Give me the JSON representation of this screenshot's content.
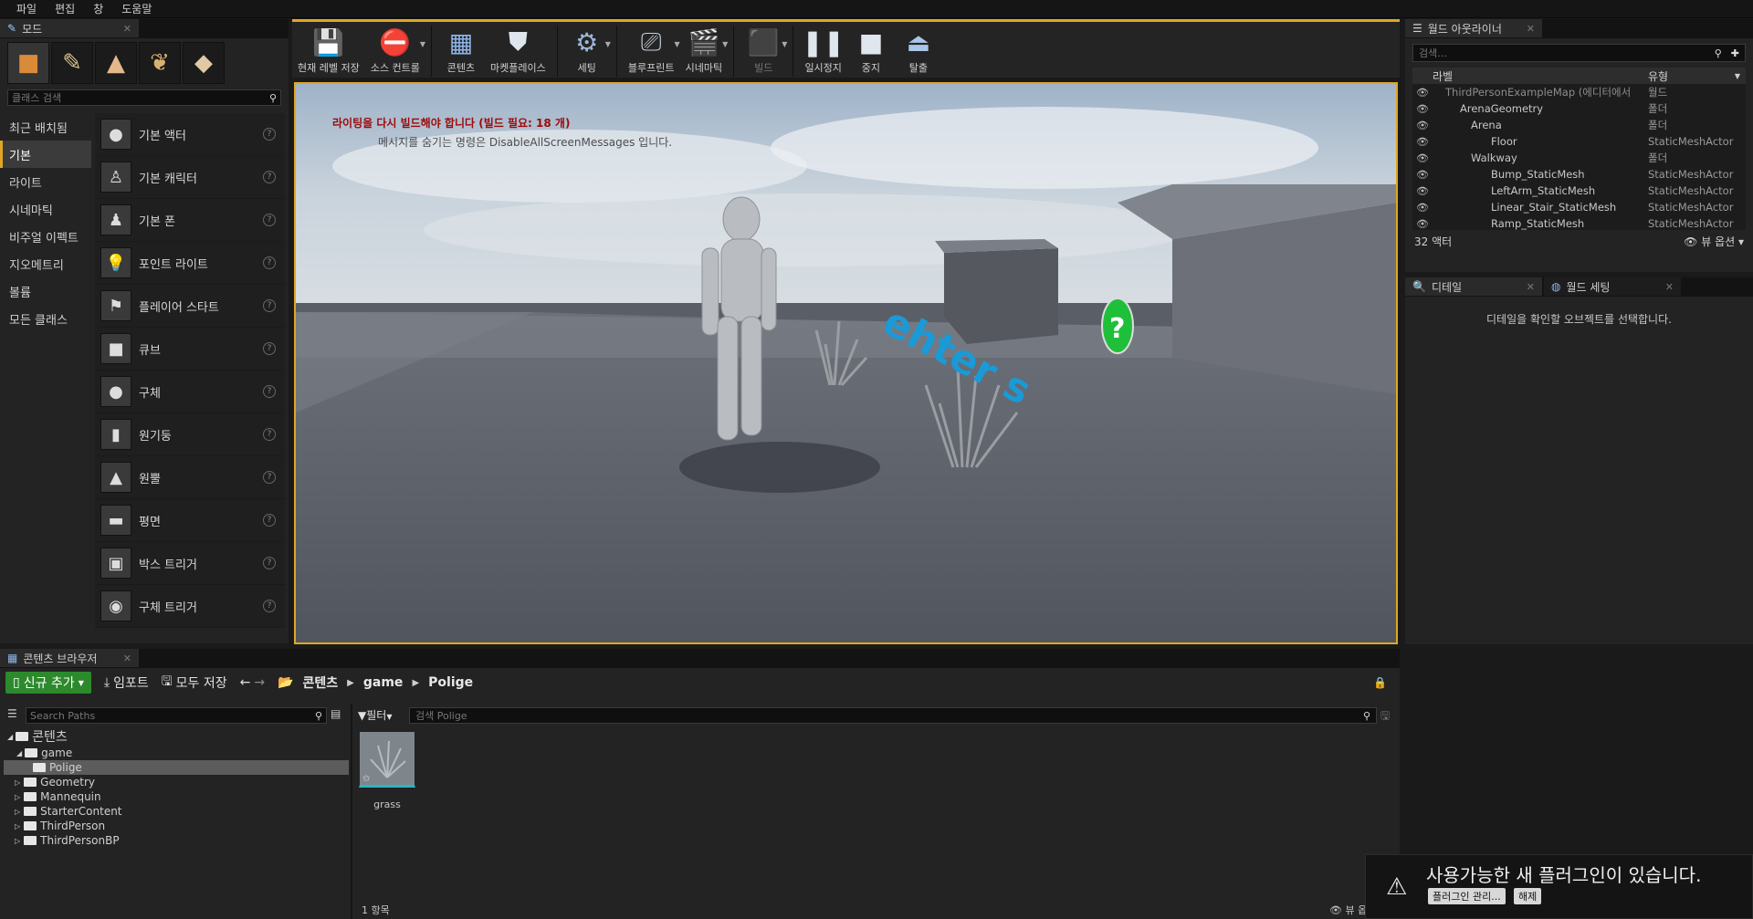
{
  "menu": [
    "파일",
    "편집",
    "창",
    "도움말"
  ],
  "modes": {
    "tab_title": "모드",
    "search_placeholder": "클래스 검색",
    "categories": [
      "최근 배치됨",
      "기본",
      "라이트",
      "시네마틱",
      "비주얼 이펙트",
      "지오메트리",
      "볼륨",
      "모든 클래스"
    ],
    "actors": [
      "기본 액터",
      "기본 캐릭터",
      "기본 폰",
      "포인트 라이트",
      "플레이어 스타트",
      "큐브",
      "구체",
      "원기둥",
      "원뿔",
      "평면",
      "박스 트리거",
      "구체 트리거"
    ]
  },
  "toolbar": {
    "save": "현재 레벨 저장",
    "source_control": "소스 컨트롤",
    "content": "콘텐츠",
    "marketplace": "마켓플레이스",
    "settings": "세팅",
    "blueprint": "블루프린트",
    "cinematics": "시네마틱",
    "build": "빌드",
    "pause": "일시정지",
    "stop": "중지",
    "eject": "탈출"
  },
  "viewport": {
    "lighting_message": "라이팅을 다시 빌드해야 합니다 (빌드 필요: 18 개)",
    "hint_message": "메시지를 숨기는 명령은 DisableAllScreenMessages 입니다."
  },
  "outliner": {
    "tab_title": "월드 아웃라이너",
    "search_placeholder": "검색...",
    "col_label": "라벨",
    "col_type": "유형",
    "rows": [
      {
        "name": "ThirdPersonExampleMap (에디터에서",
        "type": "월드"
      },
      {
        "name": "ArenaGeometry",
        "type": "폴더"
      },
      {
        "name": "Arena",
        "type": "폴더"
      },
      {
        "name": "Floor",
        "type": "StaticMeshActor"
      },
      {
        "name": "Walkway",
        "type": "폴더"
      },
      {
        "name": "Bump_StaticMesh",
        "type": "StaticMeshActor"
      },
      {
        "name": "LeftArm_StaticMesh",
        "type": "StaticMeshActor"
      },
      {
        "name": "Linear_Stair_StaticMesh",
        "type": "StaticMeshActor"
      },
      {
        "name": "Ramp_StaticMesh",
        "type": "StaticMeshActor"
      }
    ],
    "actor_count": "32 액터",
    "view_options": "뷰 옵션"
  },
  "details": {
    "tab_details": "디테일",
    "tab_world_settings": "월드 세팅",
    "empty_message": "디테일을 확인할 오브젝트를 선택합니다."
  },
  "content_browser": {
    "tab_title": "콘텐츠 브라우저",
    "add_new": "신규 추가",
    "import": "임포트",
    "save_all": "모두 저장",
    "breadcrumbs": [
      "콘텐츠",
      "game",
      "Polige"
    ],
    "tree_search_placeholder": "Search Paths",
    "filter": "필터",
    "asset_search_placeholder": "검색 Polige",
    "tree": [
      {
        "label": "콘텐츠",
        "depth": 0
      },
      {
        "label": "game",
        "depth": 1
      },
      {
        "label": "Polige",
        "depth": 2
      },
      {
        "label": "Geometry",
        "depth": 1
      },
      {
        "label": "Mannequin",
        "depth": 1
      },
      {
        "label": "StarterContent",
        "depth": 1
      },
      {
        "label": "ThirdPerson",
        "depth": 1
      },
      {
        "label": "ThirdPersonBP",
        "depth": 1
      }
    ],
    "asset_name": "grass",
    "item_count": "1 항목",
    "view_options": "뷰 옵션"
  },
  "notification": {
    "message": "사용가능한 새 플러그인이 있습니다.",
    "manage_button": "플러그인 관리...",
    "dismiss_button": "해제"
  }
}
